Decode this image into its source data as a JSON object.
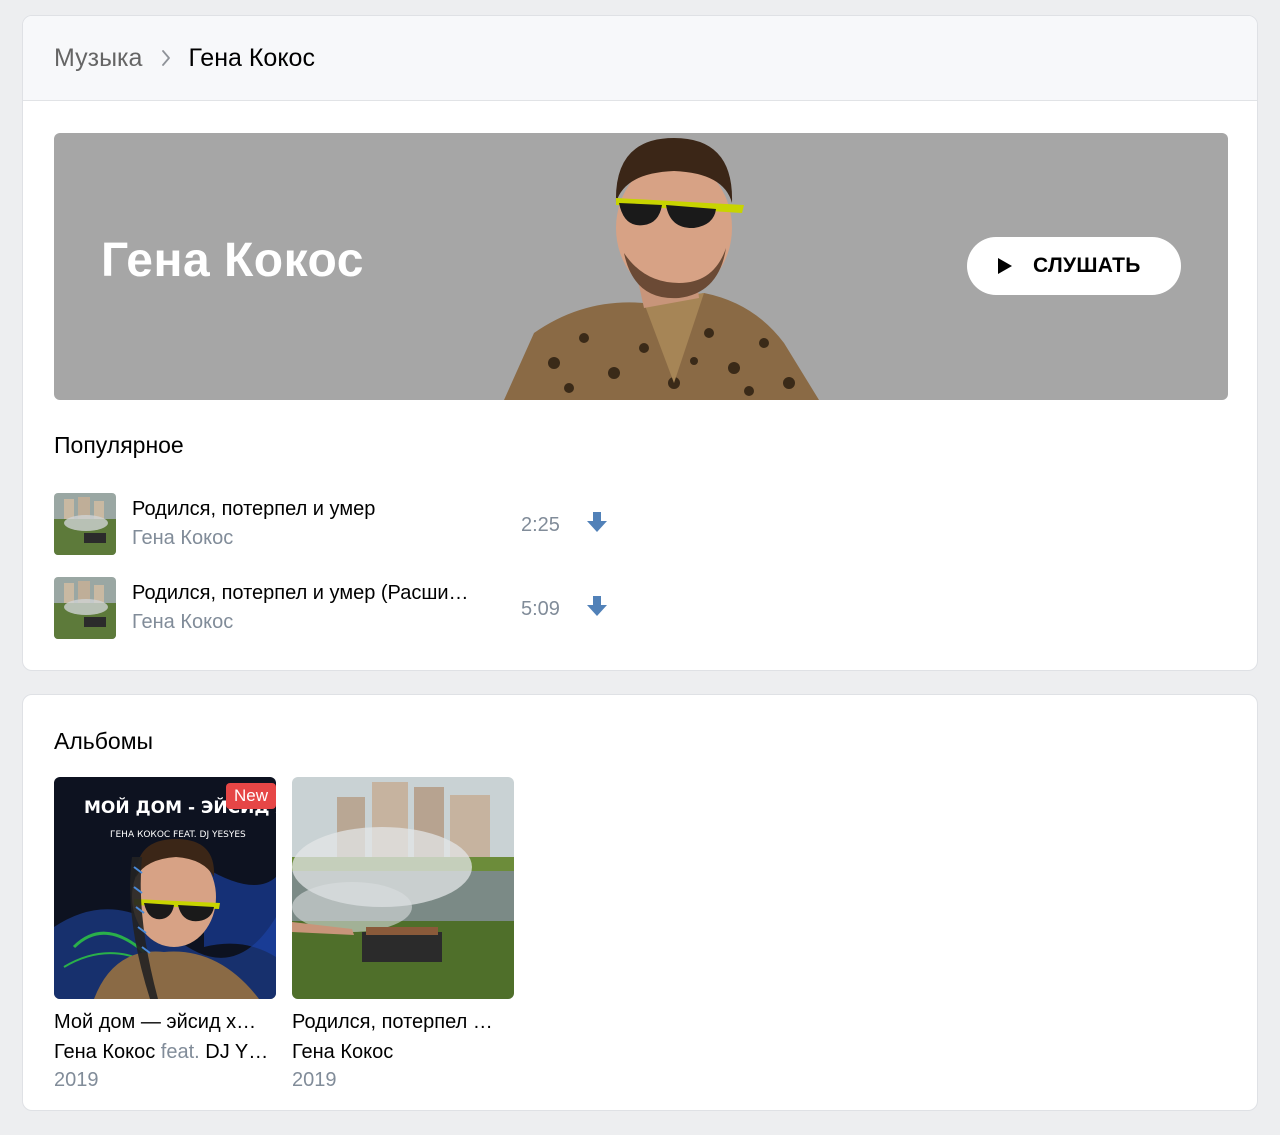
{
  "breadcrumb": {
    "root": "Музыка",
    "current": "Гена Кокос"
  },
  "banner": {
    "artist_name": "Гена Кокос",
    "listen_label": "СЛУШАТЬ"
  },
  "popular": {
    "title": "Популярное",
    "tracks": [
      {
        "name": "Родился, потерпел и умер",
        "artist": "Гена Кокос",
        "duration": "2:25"
      },
      {
        "name": "Родился, потерпел и умер (Расши…",
        "artist": "Гена Кокос",
        "duration": "5:09"
      }
    ]
  },
  "albums": {
    "title": "Альбомы",
    "items": [
      {
        "title": "Мой дом — эйсид х…",
        "artist": "Гена Кокос",
        "feat": " feat. ",
        "feat_artist": "DJ Y…",
        "year": "2019",
        "badge": "New",
        "cover_text_1": "МОЙ ДОМ - ЭЙСИД ХАУС",
        "cover_text_2": "ГЕНА КОКОС FEAT. DJ YESYES"
      },
      {
        "title": "Родился, потерпел …",
        "artist": "Гена Кокос",
        "year": "2019"
      }
    ]
  },
  "colors": {
    "page_bg": "#edeef0",
    "banner_bg": "#a6a6a6",
    "secondary_text": "#818c99",
    "download_icon": "#5181b8",
    "new_badge": "#e64646"
  },
  "icons": [
    "chevron-right-icon",
    "play-icon",
    "download-icon"
  ]
}
